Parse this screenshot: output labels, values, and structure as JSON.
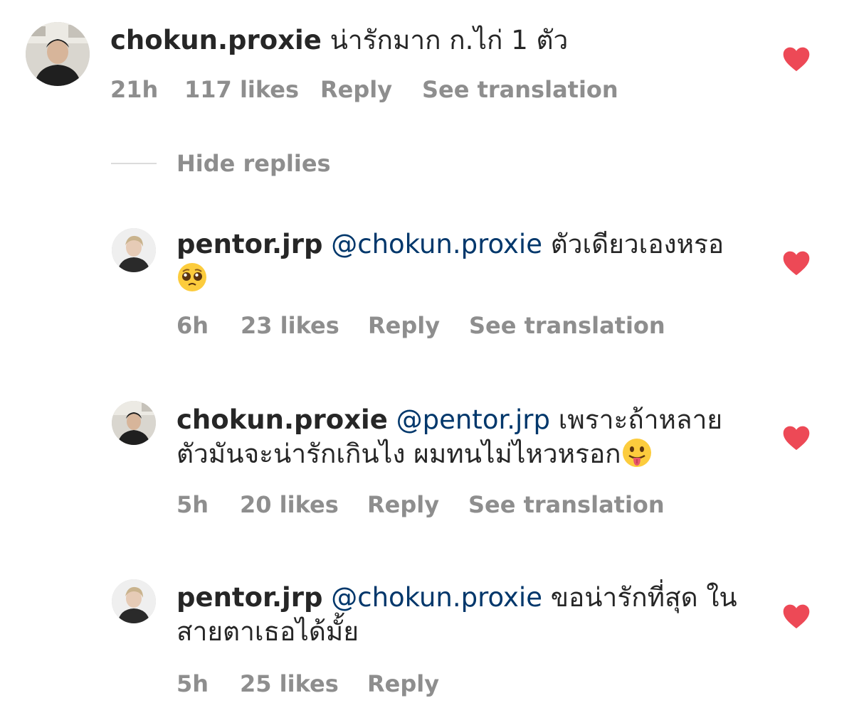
{
  "colors": {
    "username": "#262626",
    "mention": "#00376b",
    "meta": "#8e8e8e",
    "heart": "#ed4956",
    "divider": "#dbdbdb"
  },
  "comments": [
    {
      "username": "chokun.proxie",
      "mention": "",
      "text_lines": [
        "น่ารักมาก ก.ไก่ 1 ตัว"
      ],
      "time": "21h",
      "likes": "117 likes",
      "reply": "Reply",
      "translation": "See translation",
      "liked": true
    }
  ],
  "hide_replies": "Hide replies",
  "replies": [
    {
      "username": "pentor.jrp",
      "mention": "@chokun.proxie",
      "text_line1": "ตัวเดียวเองหรอ",
      "text_line2": "",
      "emoji": "pleading-face-emoji",
      "time": "6h",
      "likes": "23 likes",
      "reply": "Reply",
      "translation": "See translation",
      "liked": true
    },
    {
      "username": "chokun.proxie",
      "mention": "@pentor.jrp",
      "text_line1": "เพราะถ้าหลาย",
      "text_line2": "ตัวมันจะน่ารักเกินไง ผมทนไม่ไหวหรอก",
      "emoji": "tongue-out-emoji",
      "time": "5h",
      "likes": "20 likes",
      "reply": "Reply",
      "translation": "See translation",
      "liked": true
    },
    {
      "username": "pentor.jrp",
      "mention": "@chokun.proxie",
      "text_line1": "ขอน่ารักที่สุด ใน",
      "text_line2": "สายตาเธอได้มั้ย",
      "emoji": "",
      "time": "5h",
      "likes": "25 likes",
      "reply": "Reply",
      "translation": "",
      "liked": true
    }
  ]
}
